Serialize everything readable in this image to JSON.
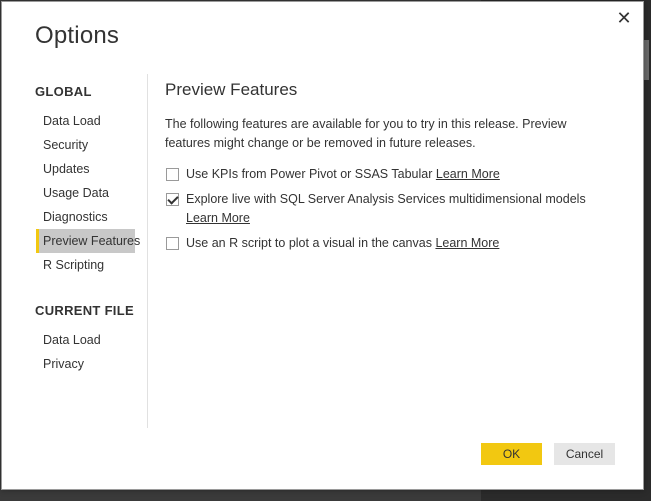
{
  "dialog": {
    "title": "Options",
    "close_glyph": "✕"
  },
  "sidebar": {
    "global_heading": "GLOBAL",
    "global_items": [
      {
        "label": "Data Load"
      },
      {
        "label": "Security"
      },
      {
        "label": "Updates"
      },
      {
        "label": "Usage Data"
      },
      {
        "label": "Diagnostics"
      },
      {
        "label": "Preview Features",
        "active": true
      },
      {
        "label": "R Scripting"
      }
    ],
    "current_file_heading": "CURRENT FILE",
    "current_file_items": [
      {
        "label": "Data Load"
      },
      {
        "label": "Privacy"
      }
    ]
  },
  "content": {
    "title": "Preview Features",
    "description": "The following features are available for you to try in this release. Preview features might change or be removed in future releases.",
    "features": [
      {
        "label": "Use KPIs from Power Pivot or SSAS Tabular",
        "link": "Learn More",
        "checked": false
      },
      {
        "label": "Explore live with SQL Server Analysis Services multidimensional models",
        "link": "Learn More",
        "checked": true
      },
      {
        "label": "Use an R script to plot a visual in the canvas",
        "link": "Learn More",
        "checked": false
      }
    ]
  },
  "buttons": {
    "ok": "OK",
    "cancel": "Cancel"
  },
  "colors": {
    "accent": "#f2c811",
    "active_item_bg": "#c8c8c8"
  }
}
